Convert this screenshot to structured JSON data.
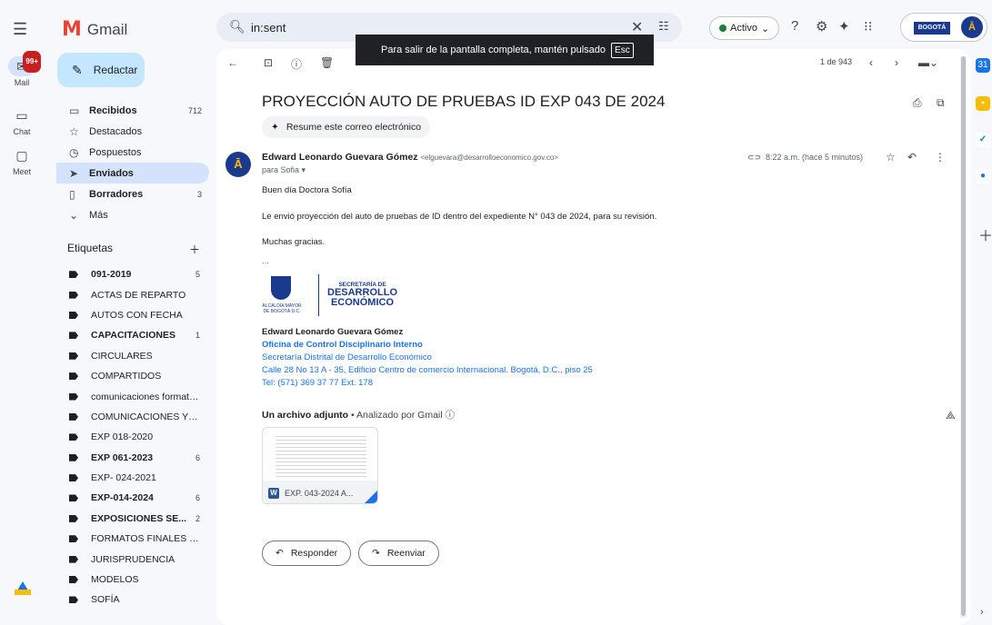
{
  "rail": {
    "mail": {
      "label": "Mail",
      "badge": "99+"
    },
    "chat": {
      "label": "Chat"
    },
    "meet": {
      "label": "Meet"
    }
  },
  "app": {
    "name": "Gmail"
  },
  "search": {
    "value": "in:sent"
  },
  "status": {
    "label": "Activo"
  },
  "account": {
    "brand": "BOGOTÁ"
  },
  "compose": {
    "label": "Redactar"
  },
  "nav": [
    {
      "label": "Recibidos",
      "count": "712",
      "icon": "inbox-icon",
      "bold": true
    },
    {
      "label": "Destacados",
      "count": "",
      "icon": "star-icon",
      "bold": false
    },
    {
      "label": "Pospuestos",
      "count": "",
      "icon": "clock-icon",
      "bold": false
    },
    {
      "label": "Enviados",
      "count": "",
      "icon": "send-icon",
      "bold": true,
      "selected": true
    },
    {
      "label": "Borradores",
      "count": "3",
      "icon": "draft-icon",
      "bold": true
    },
    {
      "label": "Más",
      "count": "",
      "icon": "chevron-down-icon",
      "bold": false
    }
  ],
  "labels_title": "Etiquetas",
  "labels": [
    {
      "label": "091-2019",
      "count": "5",
      "bold": true
    },
    {
      "label": "ACTAS DE REPARTO",
      "count": "",
      "bold": false
    },
    {
      "label": "AUTOS CON FECHA",
      "count": "",
      "bold": false
    },
    {
      "label": "CAPACITACIONES",
      "count": "1",
      "bold": true
    },
    {
      "label": "CIRCULARES",
      "count": "",
      "bold": false
    },
    {
      "label": "COMPARTIDOS",
      "count": "",
      "bold": false
    },
    {
      "label": "comunicaciones formato...",
      "count": "",
      "bold": false
    },
    {
      "label": "COMUNICACIONES Y/O ...",
      "count": "",
      "bold": false
    },
    {
      "label": "EXP 018-2020",
      "count": "",
      "bold": false
    },
    {
      "label": "EXP 061-2023",
      "count": "6",
      "bold": true
    },
    {
      "label": "EXP- 024-2021",
      "count": "",
      "bold": false
    },
    {
      "label": "EXP-014-2024",
      "count": "6",
      "bold": true
    },
    {
      "label": "EXPOSICIONES SE...",
      "count": "2",
      "bold": true
    },
    {
      "label": "FORMATOS FINALES PR...",
      "count": "",
      "bold": false
    },
    {
      "label": "JURISPRUDENCIA",
      "count": "",
      "bold": false
    },
    {
      "label": "MODELOS",
      "count": "",
      "bold": false
    },
    {
      "label": "SOFÍA",
      "count": "",
      "bold": false
    }
  ],
  "toolbar": {
    "pager": "1 de 943"
  },
  "toast": {
    "text": "Para salir de la pantalla completa, mantén pulsado",
    "key": "Esc"
  },
  "email": {
    "subject": "PROYECCIÓN AUTO DE PRUEBAS ID EXP 043 DE 2024",
    "summarize": "Resume este correo electrónico",
    "sender_name": "Edward Leonardo Guevara Gómez",
    "sender_email": "<elguevara@desarrolloeconomico.gov.co>",
    "to": "para Sofia",
    "time": "8:22 a.m. (hace 5 minutos)",
    "body": [
      "Buen día Doctora Sofía",
      "Le envió proyección del auto de pruebas de ID dentro del expediente N° 043 de 2024, para su revisión.",
      "Muchas gracias."
    ],
    "ellipsis": "...",
    "signature": {
      "logo_alcaldia": "ALCALDÍA MAYOR DE BOGOTÁ D.C.",
      "logo_secretaria": "SECRETARÍA DE",
      "logo_desarrollo": "DESARROLLO",
      "logo_economico": "ECONÓMICO",
      "name": "Edward Leonardo Guevara Gómez",
      "office": "Oficina de Control Disciplinario Interno",
      "entity": "Secretaría Distrital de Desarrollo Económico",
      "address": "Calle 28 No 13 A - 35, Edificio Centro de comercio Internacional. Bogotá, D.C., piso 25",
      "phone": "Tel: (571) 369 37 77 Ext. 178"
    },
    "attachments_title": "Un archivo adjunto",
    "attachments_note": "Analizado por Gmail",
    "attachment": {
      "name": "EXP. 043-2024 A...",
      "type": "W"
    },
    "reply": "Responder",
    "forward": "Reenviar"
  }
}
